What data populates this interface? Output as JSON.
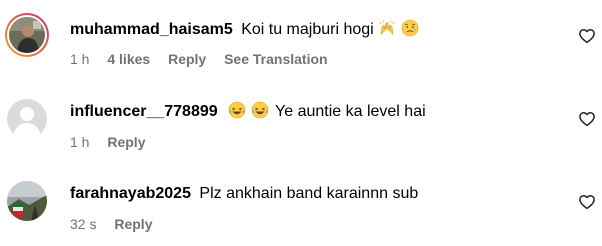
{
  "comments": [
    {
      "username": "muhammad_haisam5",
      "text": "Koi tu majburi hogi",
      "emojis": [
        "raising-hands-emoji",
        "sad-relieved-face-emoji"
      ],
      "time": "1 h",
      "likes": "4 likes",
      "reply": "Reply",
      "translation": "See Translation",
      "avatar": "user-photo-with-story-ring"
    },
    {
      "username": "influencer__778899",
      "text": "Ye auntie ka level hai",
      "emojis": [
        "laughing-tears-emoji",
        "laughing-tears-emoji"
      ],
      "time": "1 h",
      "reply": "Reply",
      "avatar": "default-avatar"
    },
    {
      "username": "farahnayab2025",
      "text": "Plz ankhain band karainnn sub",
      "time": "32 s",
      "reply": "Reply",
      "avatar": "user-photo"
    }
  ],
  "colors": {
    "text": "#000000",
    "meta": "#737373",
    "ring_start": "#f9a825",
    "ring_end": "#c13584"
  },
  "icons": {
    "like": "heart-outline-icon"
  }
}
